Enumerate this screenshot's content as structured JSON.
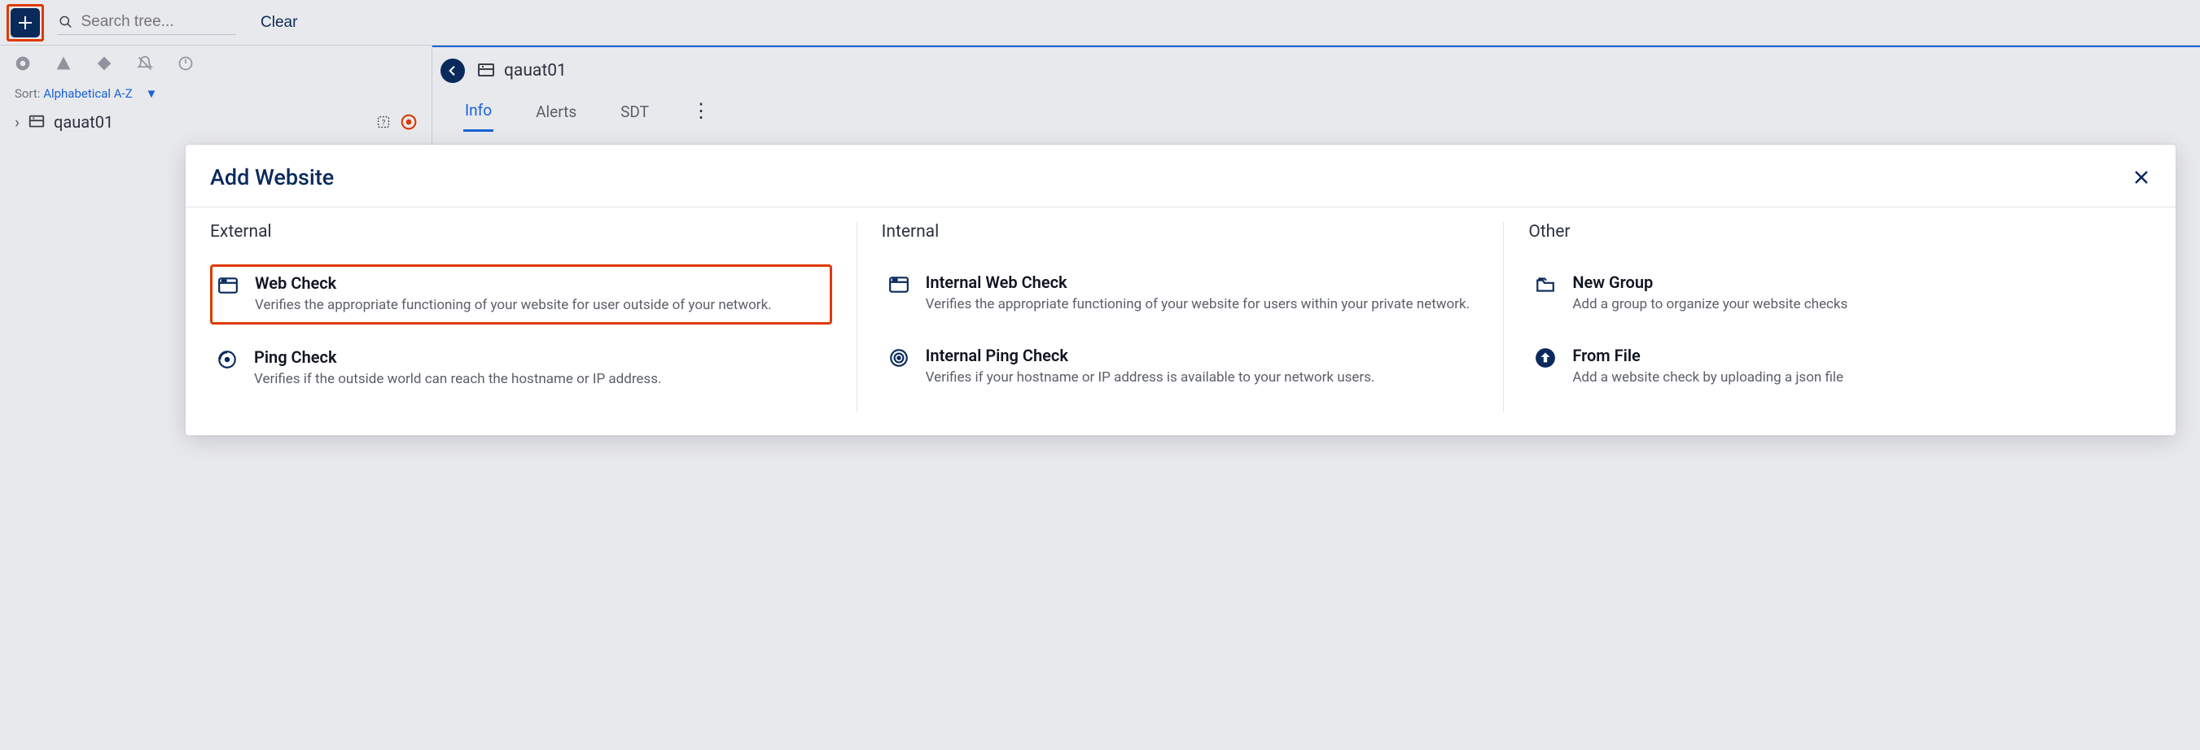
{
  "toolbar": {
    "search_placeholder": "Search tree...",
    "clear_label": "Clear"
  },
  "sort": {
    "label": "Sort:",
    "value": "Alphabetical A-Z"
  },
  "tree": {
    "item0": "qauat01"
  },
  "detail": {
    "title": "qauat01",
    "tabs": {
      "info": "Info",
      "alerts": "Alerts",
      "sdt": "SDT"
    }
  },
  "modal": {
    "title": "Add Website",
    "cols": {
      "external": {
        "heading": "External",
        "web_check": {
          "title": "Web Check",
          "desc": "Verifies the appropriate functioning of your website for user outside of your network."
        },
        "ping_check": {
          "title": "Ping Check",
          "desc": "Verifies if the outside world can reach the hostname or IP address."
        }
      },
      "internal": {
        "heading": "Internal",
        "web_check": {
          "title": "Internal Web Check",
          "desc": "Verifies the appropriate functioning of your website for users within your private network."
        },
        "ping_check": {
          "title": "Internal Ping Check",
          "desc": "Verifies if your hostname or IP address is available to your network users."
        }
      },
      "other": {
        "heading": "Other",
        "new_group": {
          "title": "New Group",
          "desc": "Add a group to organize your website checks"
        },
        "from_file": {
          "title": "From File",
          "desc": "Add a website check by uploading a json file"
        }
      }
    }
  }
}
